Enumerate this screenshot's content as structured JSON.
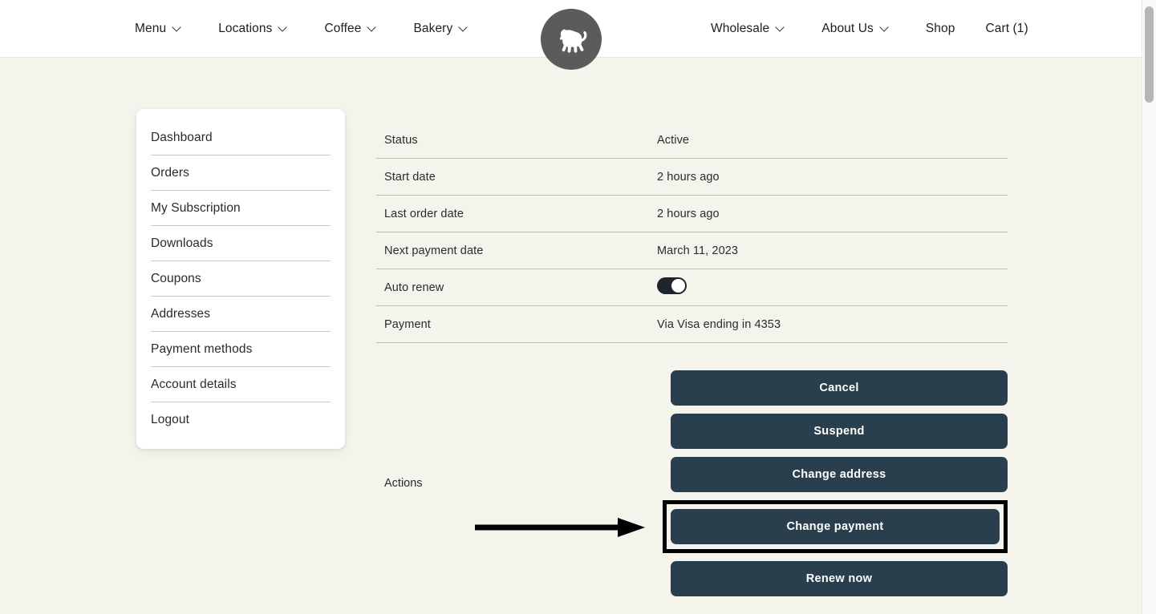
{
  "topnav": {
    "left_items": [
      {
        "label": "Menu",
        "has_chevron": true
      },
      {
        "label": "Locations",
        "has_chevron": true
      },
      {
        "label": "Coffee",
        "has_chevron": true
      },
      {
        "label": "Bakery",
        "has_chevron": true
      }
    ],
    "right_items": [
      {
        "label": "Wholesale",
        "has_chevron": true
      },
      {
        "label": "About Us",
        "has_chevron": true
      },
      {
        "label": "Shop",
        "has_chevron": false
      },
      {
        "label": "Cart (1)",
        "has_chevron": false
      }
    ],
    "logo_icon": "monkey-logo-icon"
  },
  "sidebar": {
    "items": [
      {
        "label": "Dashboard"
      },
      {
        "label": "Orders"
      },
      {
        "label": "My Subscription"
      },
      {
        "label": "Downloads"
      },
      {
        "label": "Coupons"
      },
      {
        "label": "Addresses"
      },
      {
        "label": "Payment methods"
      },
      {
        "label": "Account details"
      },
      {
        "label": "Logout"
      }
    ]
  },
  "subscription": {
    "rows": [
      {
        "label": "Status",
        "value": "Active"
      },
      {
        "label": "Start date",
        "value": "2 hours ago"
      },
      {
        "label": "Last order date",
        "value": "2 hours ago"
      },
      {
        "label": "Next payment date",
        "value": "March 11, 2023"
      },
      {
        "label": "Auto renew",
        "value": "",
        "type": "toggle",
        "toggle_on": true
      },
      {
        "label": "Payment",
        "value": "Via Visa ending in 4353"
      }
    ],
    "actions_label": "Actions",
    "actions": [
      {
        "label": "Cancel",
        "highlighted": false
      },
      {
        "label": "Suspend",
        "highlighted": false
      },
      {
        "label": "Change address",
        "highlighted": false
      },
      {
        "label": "Change payment",
        "highlighted": true
      },
      {
        "label": "Renew now",
        "highlighted": false
      }
    ]
  },
  "annotation": {
    "arrow_icon": "right-arrow-annotation-icon",
    "highlight_color": "#000000"
  },
  "colors": {
    "page_background": "#F4F4EC",
    "nav_background": "#FFFFFF",
    "button": "#2A3F4D",
    "card": "#FFFFFF",
    "logo": "#5B5B5B",
    "text": "#2B2B2B"
  },
  "scrollbar": {
    "position": "right",
    "thumb_at_top": true
  }
}
